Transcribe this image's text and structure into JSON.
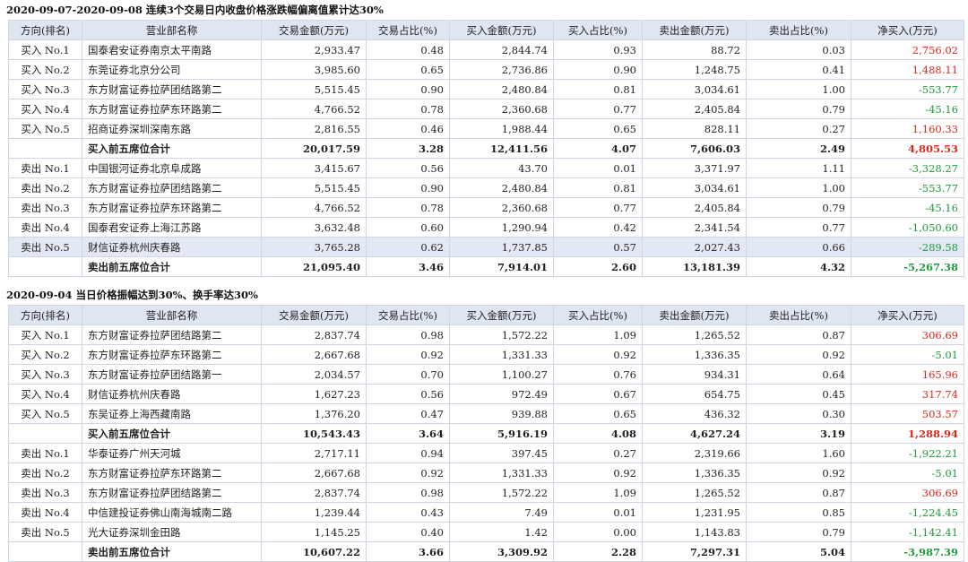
{
  "headers": [
    "方向(排名)",
    "营业部名称",
    "交易金额(万元)",
    "交易占比(%)",
    "买入金额(万元)",
    "买入占比(%)",
    "卖出金额(万元)",
    "卖出占比(%)",
    "净买入(万元)"
  ],
  "colors": {
    "positive": "#e0261b",
    "negative": "#1f9a3c",
    "header_bg": "#dfe6f1"
  },
  "sections": [
    {
      "title": "2020-09-07-2020-09-08 连续3个交易日内收盘价格涨跌幅偏离值累计达30%",
      "rows": [
        {
          "cells": [
            "买入 No.1",
            "国泰君安证券南京太平南路",
            "2,933.47",
            "0.48",
            "2,844.74",
            "0.93",
            "88.72",
            "0.03",
            "2,756.02"
          ],
          "sign": "pos"
        },
        {
          "cells": [
            "买入 No.2",
            "东莞证券北京分公司",
            "3,985.60",
            "0.65",
            "2,736.86",
            "0.90",
            "1,248.75",
            "0.41",
            "1,488.11"
          ],
          "sign": "pos"
        },
        {
          "cells": [
            "买入 No.3",
            "东方财富证券拉萨团结路第二",
            "5,515.45",
            "0.90",
            "2,480.84",
            "0.81",
            "3,034.61",
            "1.00",
            "-553.77"
          ],
          "sign": "neg"
        },
        {
          "cells": [
            "买入 No.4",
            "东方财富证券拉萨东环路第二",
            "4,766.52",
            "0.78",
            "2,360.68",
            "0.77",
            "2,405.84",
            "0.79",
            "-45.16"
          ],
          "sign": "neg"
        },
        {
          "cells": [
            "买入 No.5",
            "招商证券深圳深南东路",
            "2,816.55",
            "0.46",
            "1,988.44",
            "0.65",
            "828.11",
            "0.27",
            "1,160.33"
          ],
          "sign": "pos"
        },
        {
          "cells": [
            "",
            "买入前五席位合计",
            "20,017.59",
            "3.28",
            "12,411.56",
            "4.07",
            "7,606.03",
            "2.49",
            "4,805.53"
          ],
          "sign": "pos",
          "subtotal": true
        },
        {
          "cells": [
            "卖出 No.1",
            "中国银河证券北京阜成路",
            "3,415.67",
            "0.56",
            "43.70",
            "0.01",
            "3,371.97",
            "1.11",
            "-3,328.27"
          ],
          "sign": "neg"
        },
        {
          "cells": [
            "卖出 No.2",
            "东方财富证券拉萨团结路第二",
            "5,515.45",
            "0.90",
            "2,480.84",
            "0.81",
            "3,034.61",
            "1.00",
            "-553.77"
          ],
          "sign": "neg"
        },
        {
          "cells": [
            "卖出 No.3",
            "东方财富证券拉萨东环路第二",
            "4,766.52",
            "0.78",
            "2,360.68",
            "0.77",
            "2,405.84",
            "0.79",
            "-45.16"
          ],
          "sign": "neg"
        },
        {
          "cells": [
            "卖出 No.4",
            "国泰君安证券上海江苏路",
            "3,632.48",
            "0.60",
            "1,290.94",
            "0.42",
            "2,341.54",
            "0.77",
            "-1,050.60"
          ],
          "sign": "neg"
        },
        {
          "cells": [
            "卖出 No.5",
            "财信证券杭州庆春路",
            "3,765.28",
            "0.62",
            "1,737.85",
            "0.57",
            "2,027.43",
            "0.66",
            "-289.58"
          ],
          "sign": "neg",
          "highlight": true
        },
        {
          "cells": [
            "",
            "卖出前五席位合计",
            "21,095.40",
            "3.46",
            "7,914.01",
            "2.60",
            "13,181.39",
            "4.32",
            "-5,267.38"
          ],
          "sign": "neg",
          "subtotal": true
        }
      ]
    },
    {
      "title": "2020-09-04 当日价格振幅达到30%、换手率达30%",
      "rows": [
        {
          "cells": [
            "买入 No.1",
            "东方财富证券拉萨团结路第二",
            "2,837.74",
            "0.98",
            "1,572.22",
            "1.09",
            "1,265.52",
            "0.87",
            "306.69"
          ],
          "sign": "pos"
        },
        {
          "cells": [
            "买入 No.2",
            "东方财富证券拉萨东环路第二",
            "2,667.68",
            "0.92",
            "1,331.33",
            "0.92",
            "1,336.35",
            "0.92",
            "-5.01"
          ],
          "sign": "neg"
        },
        {
          "cells": [
            "买入 No.3",
            "东方财富证券拉萨团结路第一",
            "2,034.57",
            "0.70",
            "1,100.27",
            "0.76",
            "934.31",
            "0.64",
            "165.96"
          ],
          "sign": "pos"
        },
        {
          "cells": [
            "买入 No.4",
            "财信证券杭州庆春路",
            "1,627.23",
            "0.56",
            "972.49",
            "0.67",
            "654.75",
            "0.45",
            "317.74"
          ],
          "sign": "pos"
        },
        {
          "cells": [
            "买入 No.5",
            "东吴证券上海西藏南路",
            "1,376.20",
            "0.47",
            "939.88",
            "0.65",
            "436.32",
            "0.30",
            "503.57"
          ],
          "sign": "pos"
        },
        {
          "cells": [
            "",
            "买入前五席位合计",
            "10,543.43",
            "3.64",
            "5,916.19",
            "4.08",
            "4,627.24",
            "3.19",
            "1,288.94"
          ],
          "sign": "pos",
          "subtotal": true
        },
        {
          "cells": [
            "卖出 No.1",
            "华泰证券广州天河城",
            "2,717.11",
            "0.94",
            "397.45",
            "0.27",
            "2,319.66",
            "1.60",
            "-1,922.21"
          ],
          "sign": "neg"
        },
        {
          "cells": [
            "卖出 No.2",
            "东方财富证券拉萨东环路第二",
            "2,667.68",
            "0.92",
            "1,331.33",
            "0.92",
            "1,336.35",
            "0.92",
            "-5.01"
          ],
          "sign": "neg"
        },
        {
          "cells": [
            "卖出 No.3",
            "东方财富证券拉萨团结路第二",
            "2,837.74",
            "0.98",
            "1,572.22",
            "1.09",
            "1,265.52",
            "0.87",
            "306.69"
          ],
          "sign": "pos"
        },
        {
          "cells": [
            "卖出 No.4",
            "中信建投证券佛山南海城南二路",
            "1,239.44",
            "0.43",
            "7.49",
            "0.01",
            "1,231.95",
            "0.85",
            "-1,224.45"
          ],
          "sign": "neg"
        },
        {
          "cells": [
            "卖出 No.5",
            "光大证券深圳金田路",
            "1,145.25",
            "0.40",
            "1.42",
            "0.00",
            "1,143.83",
            "0.79",
            "-1,142.41"
          ],
          "sign": "neg"
        },
        {
          "cells": [
            "",
            "卖出前五席位合计",
            "10,607.22",
            "3.66",
            "3,309.92",
            "2.28",
            "7,297.31",
            "5.04",
            "-3,987.39"
          ],
          "sign": "neg",
          "subtotal": true
        }
      ]
    }
  ]
}
